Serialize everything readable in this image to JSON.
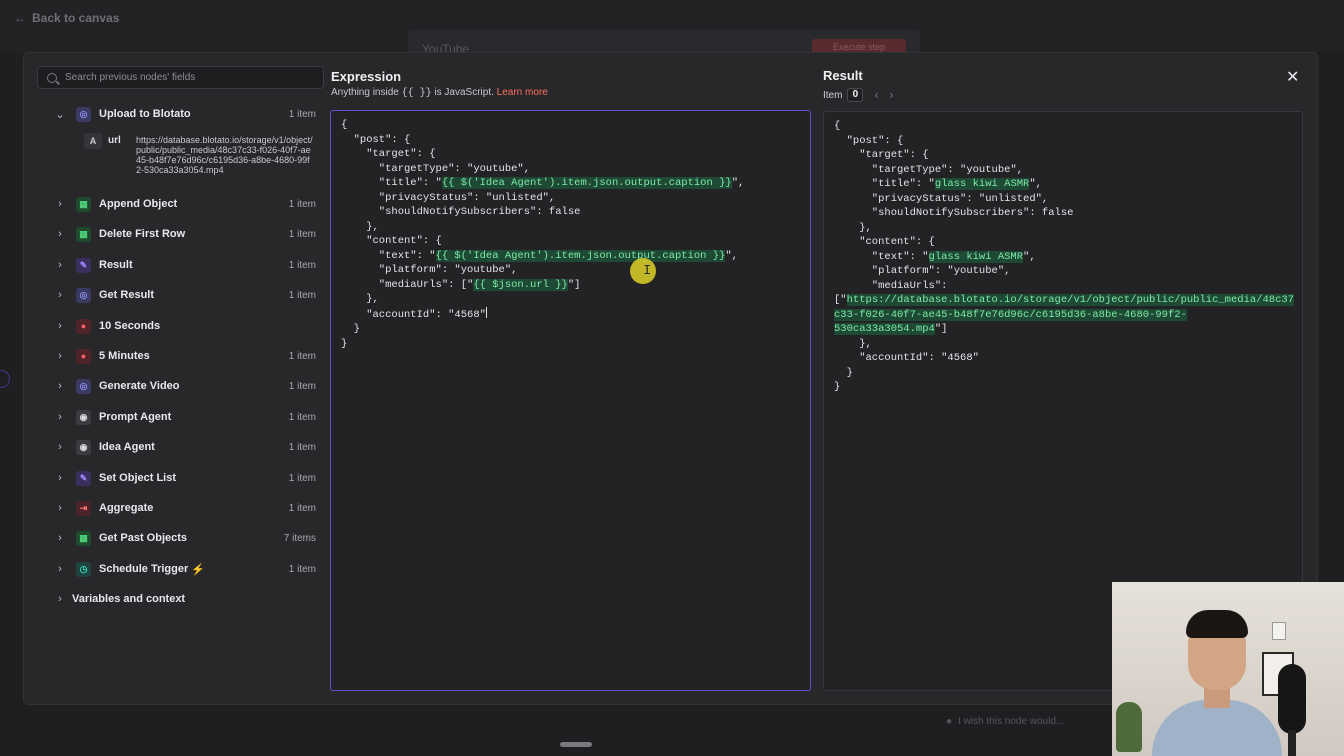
{
  "background": {
    "back_link": "Back to canvas",
    "node_tab": "YouTube",
    "execute_button": "Execute step",
    "bottom_note": "I wish this node would..."
  },
  "search": {
    "placeholder": "Search previous nodes' fields"
  },
  "nodes": [
    {
      "label": "Upload to Blotato",
      "count": "1 item",
      "expanded": true,
      "icon": "globe-icon"
    },
    {
      "label": "Append Object",
      "count": "1 item",
      "icon": "sheet-icon"
    },
    {
      "label": "Delete First Row",
      "count": "1 item",
      "icon": "sheet-icon"
    },
    {
      "label": "Result",
      "count": "1 item",
      "icon": "pencil-icon"
    },
    {
      "label": "Get Result",
      "count": "1 item",
      "icon": "globe-icon"
    },
    {
      "label": "10 Seconds",
      "count": "",
      "icon": "pause-icon"
    },
    {
      "label": "5 Minutes",
      "count": "1 item",
      "icon": "pause-icon"
    },
    {
      "label": "Generate Video",
      "count": "1 item",
      "icon": "globe-icon"
    },
    {
      "label": "Prompt Agent",
      "count": "1 item",
      "icon": "robot-icon"
    },
    {
      "label": "Idea Agent",
      "count": "1 item",
      "icon": "robot-icon"
    },
    {
      "label": "Set Object List",
      "count": "1 item",
      "icon": "pencil-icon"
    },
    {
      "label": "Aggregate",
      "count": "1 item",
      "icon": "aggregate-icon"
    },
    {
      "label": "Get Past Objects",
      "count": "7 items",
      "icon": "sheet-icon"
    },
    {
      "label": "Schedule Trigger",
      "count": "1 item",
      "icon": "clock-icon"
    },
    {
      "label": "Variables and context",
      "count": "",
      "icon": ""
    }
  ],
  "url_field": {
    "type_tag": "A",
    "key": "url",
    "value": "https://database.blotato.io/storage/v1/object/public/public_media/48c37c33-f026-40f7-ae45-b48f7e76d96c/c6195d36-a8be-4680-99f2-530ca33a3054.mp4"
  },
  "expression": {
    "title": "Expression",
    "subtitle_prefix": "Anything inside",
    "subtitle_braces": "{{ }}",
    "subtitle_suffix": "is JavaScript.",
    "learn_more": "Learn more",
    "lines": {
      "l1": "{",
      "l2": "  \"post\": {",
      "l3": "    \"target\": {",
      "l4": "      \"targetType\": \"youtube\",",
      "l5a": "      \"title\": \"",
      "l5b": "{{ $('Idea Agent').item.json.output.caption }}",
      "l5c": "\",",
      "l6": "      \"privacyStatus\": \"unlisted\",",
      "l7": "      \"shouldNotifySubscribers\": false",
      "l8": "    },",
      "l9": "    \"content\": {",
      "l10a": "      \"text\": \"",
      "l10b": "{{ $('Idea Agent').item.json.output.caption }}",
      "l10c": "\",",
      "l11": "      \"platform\": \"youtube\",",
      "l12a": "      \"mediaUrls\": [\"",
      "l12b": "{{ $json.url }}",
      "l12c": "\"]",
      "l13": "    },",
      "l14": "    \"accountId\": \"4568\"",
      "l15": "  }",
      "l16": "}"
    }
  },
  "result": {
    "title": "Result",
    "item_label": "Item",
    "item_index": "0",
    "lines": {
      "l1": "{",
      "l2": "  \"post\": {",
      "l3": "    \"target\": {",
      "l4": "      \"targetType\": \"youtube\",",
      "l5a": "      \"title\": \"",
      "l5b": "glass kiwi ASMR",
      "l5c": "\",",
      "l6": "      \"privacyStatus\": \"unlisted\",",
      "l7": "      \"shouldNotifySubscribers\": false",
      "l8": "    },",
      "l9": "    \"content\": {",
      "l10a": "      \"text\": \"",
      "l10b": "glass kiwi ASMR",
      "l10c": "\",",
      "l11": "      \"platform\": \"youtube\",",
      "l12": "      \"mediaUrls\":",
      "l13a": "[\"",
      "l13b": "https://database.blotato.io/storage/v1/object/public/public_media/48c37",
      "l14": "c33-f026-40f7-ae45-b48f7e76d96c/c6195d36-a8be-4680-99f2-",
      "l15a": "530ca33a3054.mp4",
      "l15b": "\"]",
      "l16": "    },",
      "l17": "    \"accountId\": \"4568\"",
      "l18": "  }",
      "l19": "}"
    }
  },
  "colors": {
    "accent": "#ff6f5c",
    "highlight_bg": "#1e4a35",
    "highlight_fg": "#7eeaa6",
    "editor_border": "#5b54c9"
  }
}
